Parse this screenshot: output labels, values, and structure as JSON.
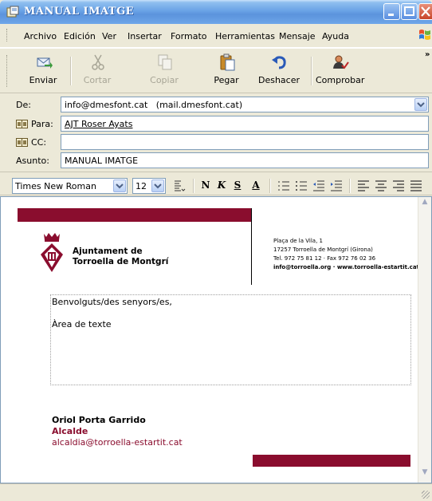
{
  "window": {
    "title": "MANUAL IMATGE"
  },
  "menu": [
    "Archivo",
    "Edición",
    "Ver",
    "Insertar",
    "Formato",
    "Herramientas",
    "Mensaje",
    "Ayuda"
  ],
  "toolbar": {
    "send": "Enviar",
    "cut": "Cortar",
    "copy": "Copiar",
    "paste": "Pegar",
    "undo": "Deshacer",
    "check": "Comprobar"
  },
  "header": {
    "from_label": "De:",
    "from_value": "info@dmesfont.cat   (mail.dmesfont.cat)",
    "to_label": "Para:",
    "to_value": "AJT Roser Ayats",
    "cc_label": "CC:",
    "cc_value": "",
    "subject_label": "Asunto:",
    "subject_value": "MANUAL IMATGE"
  },
  "format": {
    "font": "Times New Roman",
    "size": "12",
    "bold": "N",
    "italic": "K",
    "underline": "S",
    "color": "A"
  },
  "letter": {
    "org_line1": "Ajuntament de",
    "org_line2": "Torroella de Montgrí",
    "addr_line1": "Plaça de la Vila, 1",
    "addr_line2": "17257 Torroella de Montgrí (Girona)",
    "addr_line3": "Tel. 972 75 81 12 · Fax 972 76 02 36",
    "addr_line4": "info@torroella.org · www.torroella-estartit.cat",
    "greeting": "Benvolguts/des senyors/es,",
    "area": "Àrea de texte",
    "sig_name": "Oriol Porta Garrido",
    "sig_role": "Alcalde",
    "sig_mail": "alcaldia@torroella-estartit.cat"
  },
  "colors": {
    "accent": "#8a0d2e",
    "titlebar": "#5b93dc"
  }
}
